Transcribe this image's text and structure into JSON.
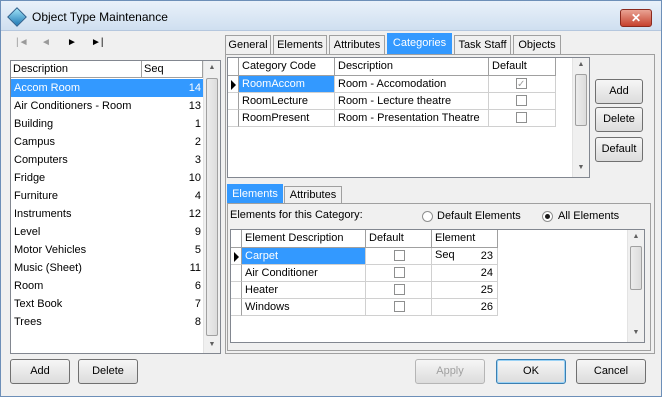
{
  "window": {
    "title": "Object Type Maintenance",
    "close_symbol": "✕"
  },
  "nav": {
    "first": "|◄",
    "prev": "◄",
    "next": "►",
    "last": "►|"
  },
  "left_list": {
    "headers": {
      "description": "Description",
      "seq": "Seq"
    },
    "rows": [
      {
        "description": "Accom Room",
        "seq": "14"
      },
      {
        "description": "Air Conditioners - Room",
        "seq": "13"
      },
      {
        "description": "Building",
        "seq": "1"
      },
      {
        "description": "Campus",
        "seq": "2"
      },
      {
        "description": "Computers",
        "seq": "3"
      },
      {
        "description": "Fridge",
        "seq": "10"
      },
      {
        "description": "Furniture",
        "seq": "4"
      },
      {
        "description": "Instruments",
        "seq": "12"
      },
      {
        "description": "Level",
        "seq": "9"
      },
      {
        "description": "Motor Vehicles",
        "seq": "5"
      },
      {
        "description": "Music (Sheet)",
        "seq": "11"
      },
      {
        "description": "Room",
        "seq": "6"
      },
      {
        "description": "Text Book",
        "seq": "7"
      },
      {
        "description": "Trees",
        "seq": "8"
      }
    ]
  },
  "tabs": [
    "General",
    "Elements",
    "Attributes",
    "Categories",
    "Task Staff",
    "Objects"
  ],
  "categories_grid": {
    "headers": {
      "code": "Category Code",
      "description": "Description",
      "default": "Default"
    },
    "rows": [
      {
        "code": "RoomAccom",
        "description": "Room - Accomodation",
        "default": true
      },
      {
        "code": "RoomLecture",
        "description": "Room - Lecture theatre",
        "default": false
      },
      {
        "code": "RoomPresent",
        "description": "Room - Presentation Theatre",
        "default": false
      }
    ]
  },
  "right_buttons": {
    "add": "Add",
    "delete": "Delete",
    "default": "Default"
  },
  "sub_tabs": [
    "Elements",
    "Attributes"
  ],
  "elements_section": {
    "label": "Elements for this Category:",
    "radio_default": "Default Elements",
    "radio_all": "All Elements",
    "selected": "All Elements"
  },
  "elements_grid": {
    "headers": {
      "description": "Element Description",
      "default": "Default",
      "seq": "Element Seq"
    },
    "rows": [
      {
        "description": "Carpet",
        "default": false,
        "seq": "23"
      },
      {
        "description": "Air Conditioner",
        "default": false,
        "seq": "24"
      },
      {
        "description": "Heater",
        "default": false,
        "seq": "25"
      },
      {
        "description": "Windows",
        "default": false,
        "seq": "26"
      }
    ]
  },
  "bottom_buttons": {
    "add": "Add",
    "delete": "Delete",
    "apply": "Apply",
    "ok": "OK",
    "cancel": "Cancel"
  }
}
